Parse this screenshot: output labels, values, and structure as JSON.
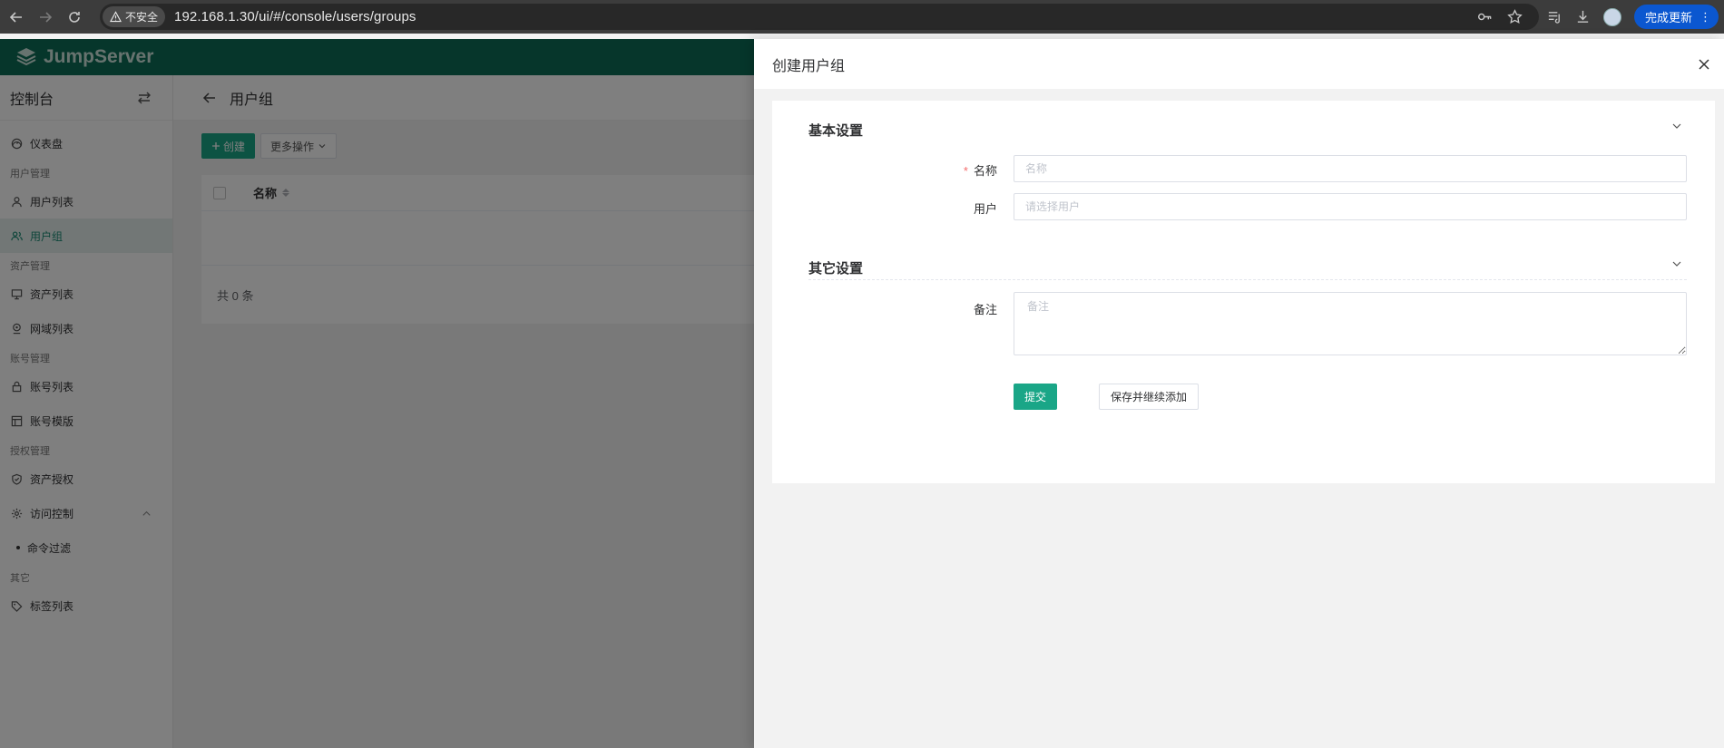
{
  "browser": {
    "security_label": "不安全",
    "url": "192.168.1.30/ui/#/console/users/groups",
    "update_label": "完成更新"
  },
  "app": {
    "logo_text": "JumpServer",
    "brand_color": "#0d6d57",
    "accent_color": "#1aa687"
  },
  "sidebar": {
    "title": "控制台",
    "items": [
      {
        "kind": "item",
        "label": "仪表盘",
        "icon": "gauge-icon"
      },
      {
        "kind": "group",
        "label": "用户管理"
      },
      {
        "kind": "item",
        "label": "用户列表",
        "icon": "user-icon"
      },
      {
        "kind": "item",
        "label": "用户组",
        "icon": "users-icon",
        "active": true
      },
      {
        "kind": "group",
        "label": "资产管理"
      },
      {
        "kind": "item",
        "label": "资产列表",
        "icon": "monitor-icon"
      },
      {
        "kind": "item",
        "label": "网域列表",
        "icon": "location-icon"
      },
      {
        "kind": "group",
        "label": "账号管理"
      },
      {
        "kind": "item",
        "label": "账号列表",
        "icon": "lock-icon"
      },
      {
        "kind": "item",
        "label": "账号模版",
        "icon": "template-icon"
      },
      {
        "kind": "group",
        "label": "授权管理"
      },
      {
        "kind": "item",
        "label": "资产授权",
        "icon": "shield-icon"
      },
      {
        "kind": "item",
        "label": "访问控制",
        "icon": "gear-icon",
        "expandable": true
      },
      {
        "kind": "sub",
        "label": "命令过滤"
      },
      {
        "kind": "group",
        "label": "其它"
      },
      {
        "kind": "item",
        "label": "标签列表",
        "icon": "tag-icon"
      }
    ]
  },
  "main": {
    "page_title": "用户组",
    "create_label": "创建",
    "more_actions_label": "更多操作",
    "table": {
      "column_name": "名称"
    },
    "total_label": "共 0 条"
  },
  "drawer": {
    "title": "创建用户组",
    "basic_section": "基本设置",
    "name_label": "名称",
    "name_placeholder": "名称",
    "users_label": "用户",
    "users_placeholder": "请选择用户",
    "other_section": "其它设置",
    "comment_label": "备注",
    "comment_placeholder": "备注",
    "submit_label": "提交",
    "save_continue_label": "保存并继续添加"
  }
}
